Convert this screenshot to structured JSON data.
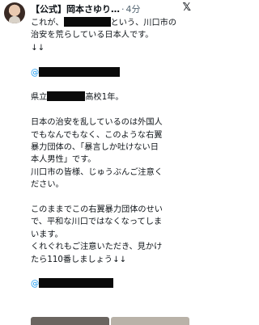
{
  "tweet": {
    "author_name": "【公式】岡本さゆり…",
    "separator": "·",
    "time": "4分",
    "logo": "𝕏",
    "lines": {
      "l1a": "これが、",
      "l1b": "という、川口市の",
      "l2": "治安を荒らしている日本人です。",
      "l3": "↓↓",
      "mention_at": "@",
      "school_prefix": "県立",
      "school_suffix": "高校1年。",
      "p1": "日本の治安を乱しているのは外国人",
      "p2": "でもなんでもなく、このような右翼",
      "p3": "暴力団体の、「暴言しか吐けない日",
      "p4": "本人男性」です。",
      "p5": "川口市の皆様、じゅうぶんご注意く",
      "p6": "ださい。",
      "q1": "このままでこの右翼暴力団体のせい",
      "q2": "で、平和な川口ではなくなってしま",
      "q3": "います。",
      "q4": "くれぐれもご注意いただき、見かけ",
      "q5": "たら110番しましょう↓↓",
      "mention2_at": "@"
    }
  }
}
